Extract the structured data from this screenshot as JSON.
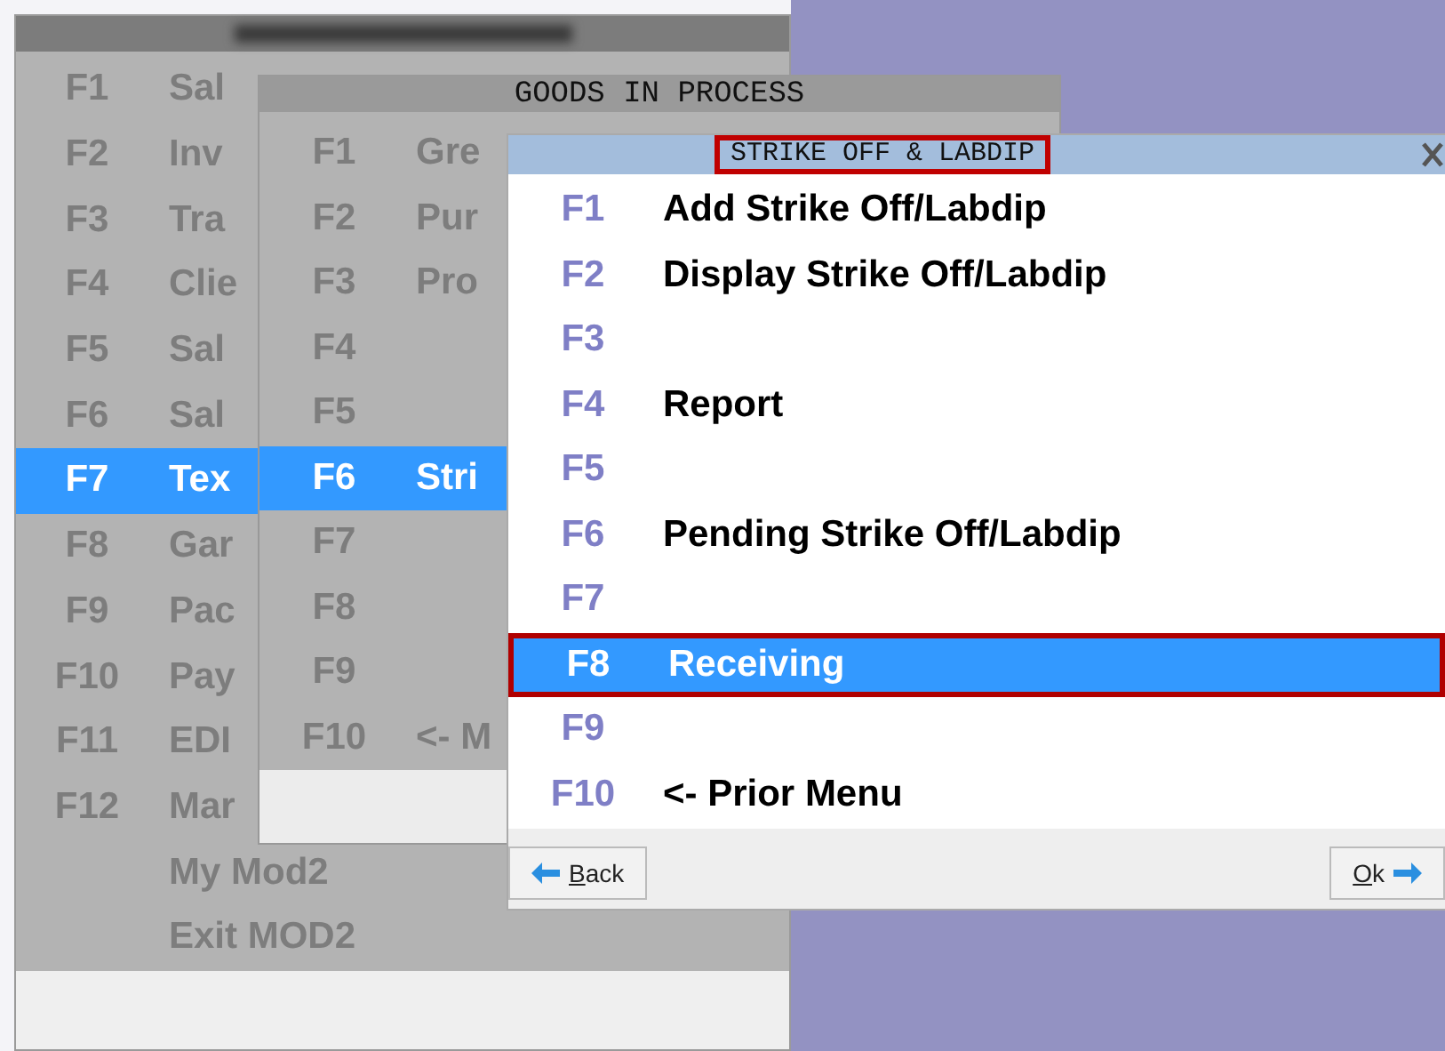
{
  "main_menu": {
    "items": [
      {
        "key": "F1",
        "label": "Sal",
        "selected": false
      },
      {
        "key": "F2",
        "label": "Inv",
        "selected": false
      },
      {
        "key": "F3",
        "label": "Tra",
        "selected": false
      },
      {
        "key": "F4",
        "label": "Clie",
        "selected": false
      },
      {
        "key": "F5",
        "label": "Sal",
        "selected": false
      },
      {
        "key": "F6",
        "label": "Sal",
        "selected": false
      },
      {
        "key": "F7",
        "label": "Tex",
        "selected": true
      },
      {
        "key": "F8",
        "label": "Gar",
        "selected": false
      },
      {
        "key": "F9",
        "label": "Pac",
        "selected": false
      },
      {
        "key": "F10",
        "label": "Pay",
        "selected": false
      },
      {
        "key": "F11",
        "label": "EDI",
        "selected": false
      },
      {
        "key": "F12",
        "label": "Mar",
        "selected": false
      },
      {
        "label": "My Mod2",
        "selected": false
      },
      {
        "label": "Exit MOD2",
        "selected": false
      }
    ]
  },
  "goods_menu": {
    "title": "GOODS IN PROCESS",
    "items": [
      {
        "key": "F1",
        "label": "Gre",
        "selected": false
      },
      {
        "key": "F2",
        "label": "Pur",
        "selected": false
      },
      {
        "key": "F3",
        "label": "Pro",
        "selected": false
      },
      {
        "key": "F4",
        "selected": false
      },
      {
        "key": "F5",
        "selected": false
      },
      {
        "key": "F6",
        "label": "Stri",
        "selected": true
      },
      {
        "key": "F7",
        "selected": false
      },
      {
        "key": "F8",
        "selected": false
      },
      {
        "key": "F9",
        "selected": false
      },
      {
        "key": "F10",
        "label": "<- M",
        "selected": false
      }
    ]
  },
  "strike_menu": {
    "title": "STRIKE OFF & LABDIP",
    "title_annotated": true,
    "items": [
      {
        "key": "F1",
        "label": "Add Strike Off/Labdip",
        "selected": false,
        "annotated": false
      },
      {
        "key": "F2",
        "label": "Display Strike Off/Labdip",
        "selected": false,
        "annotated": false
      },
      {
        "key": "F3",
        "selected": false,
        "annotated": false
      },
      {
        "key": "F4",
        "label": "Report",
        "selected": false,
        "annotated": false
      },
      {
        "key": "F5",
        "selected": false,
        "annotated": false
      },
      {
        "key": "F6",
        "label": "Pending Strike Off/Labdip",
        "selected": false,
        "annotated": false
      },
      {
        "key": "F7",
        "selected": false,
        "annotated": false
      },
      {
        "key": "F8",
        "label": "Receiving",
        "selected": true,
        "annotated": true
      },
      {
        "key": "F9",
        "selected": false,
        "annotated": false
      },
      {
        "key": "F10",
        "label": "<- Prior Menu",
        "selected": false,
        "annotated": false
      }
    ],
    "buttons": {
      "back": "Back",
      "ok": "Ok"
    }
  }
}
